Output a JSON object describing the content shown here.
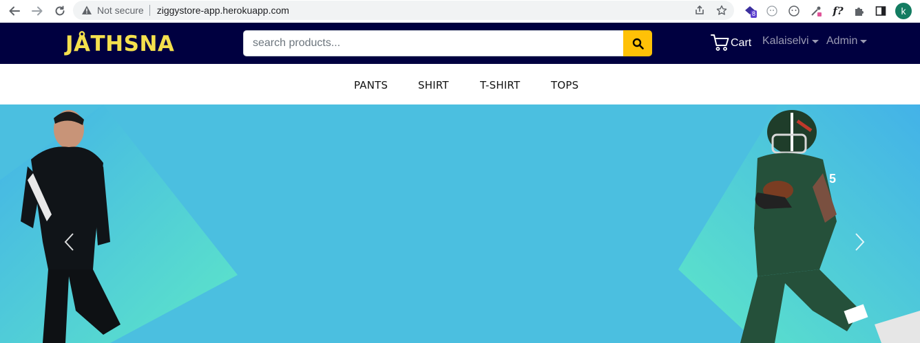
{
  "browser": {
    "security_label": "Not secure",
    "url": "ziggystore-app.herokuapp.com",
    "profile_initial": "k",
    "extension_badge": "8",
    "ext_fx_label": "f?"
  },
  "header": {
    "logo_text": "JÅTHSNA",
    "search_placeholder": "search products...",
    "cart_label": "Cart",
    "user_menu_label": "Kalaiselvi",
    "admin_menu_label": "Admin",
    "brand_color": "#000040",
    "accent_color": "#ffc107"
  },
  "categories": [
    {
      "label": "PANTS"
    },
    {
      "label": "SHIRT"
    },
    {
      "label": "T-SHIRT"
    },
    {
      "label": "TOPS"
    }
  ],
  "hero": {
    "background_color": "#4bbfe0",
    "prev_icon": "chevron-left-icon",
    "next_icon": "chevron-right-icon"
  }
}
